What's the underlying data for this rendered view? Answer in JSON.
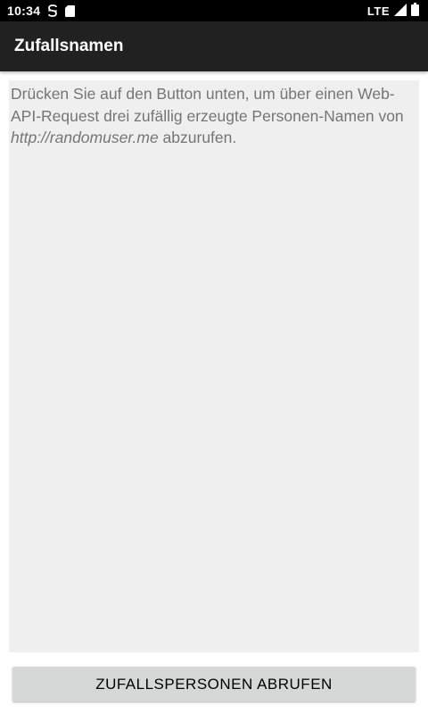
{
  "status_bar": {
    "time": "10:34",
    "network": "LTE",
    "icons": [
      "s-notification-icon",
      "sim-card-icon",
      "signal-icon",
      "battery-icon"
    ]
  },
  "app_bar": {
    "title": "Zufallsnamen",
    "background": "#212121"
  },
  "content": {
    "text_before_url": "Drücken Sie auf den Button unten, um über einen Web-API-Request drei zufällig erzeugte Personen-Namen von ",
    "url": "http://randomuser.me",
    "text_after_url": " abzurufen.",
    "background": "#efefef"
  },
  "button": {
    "label": "ZUFALLSPERSONEN ABRUFEN",
    "background": "#d6d7d7"
  }
}
